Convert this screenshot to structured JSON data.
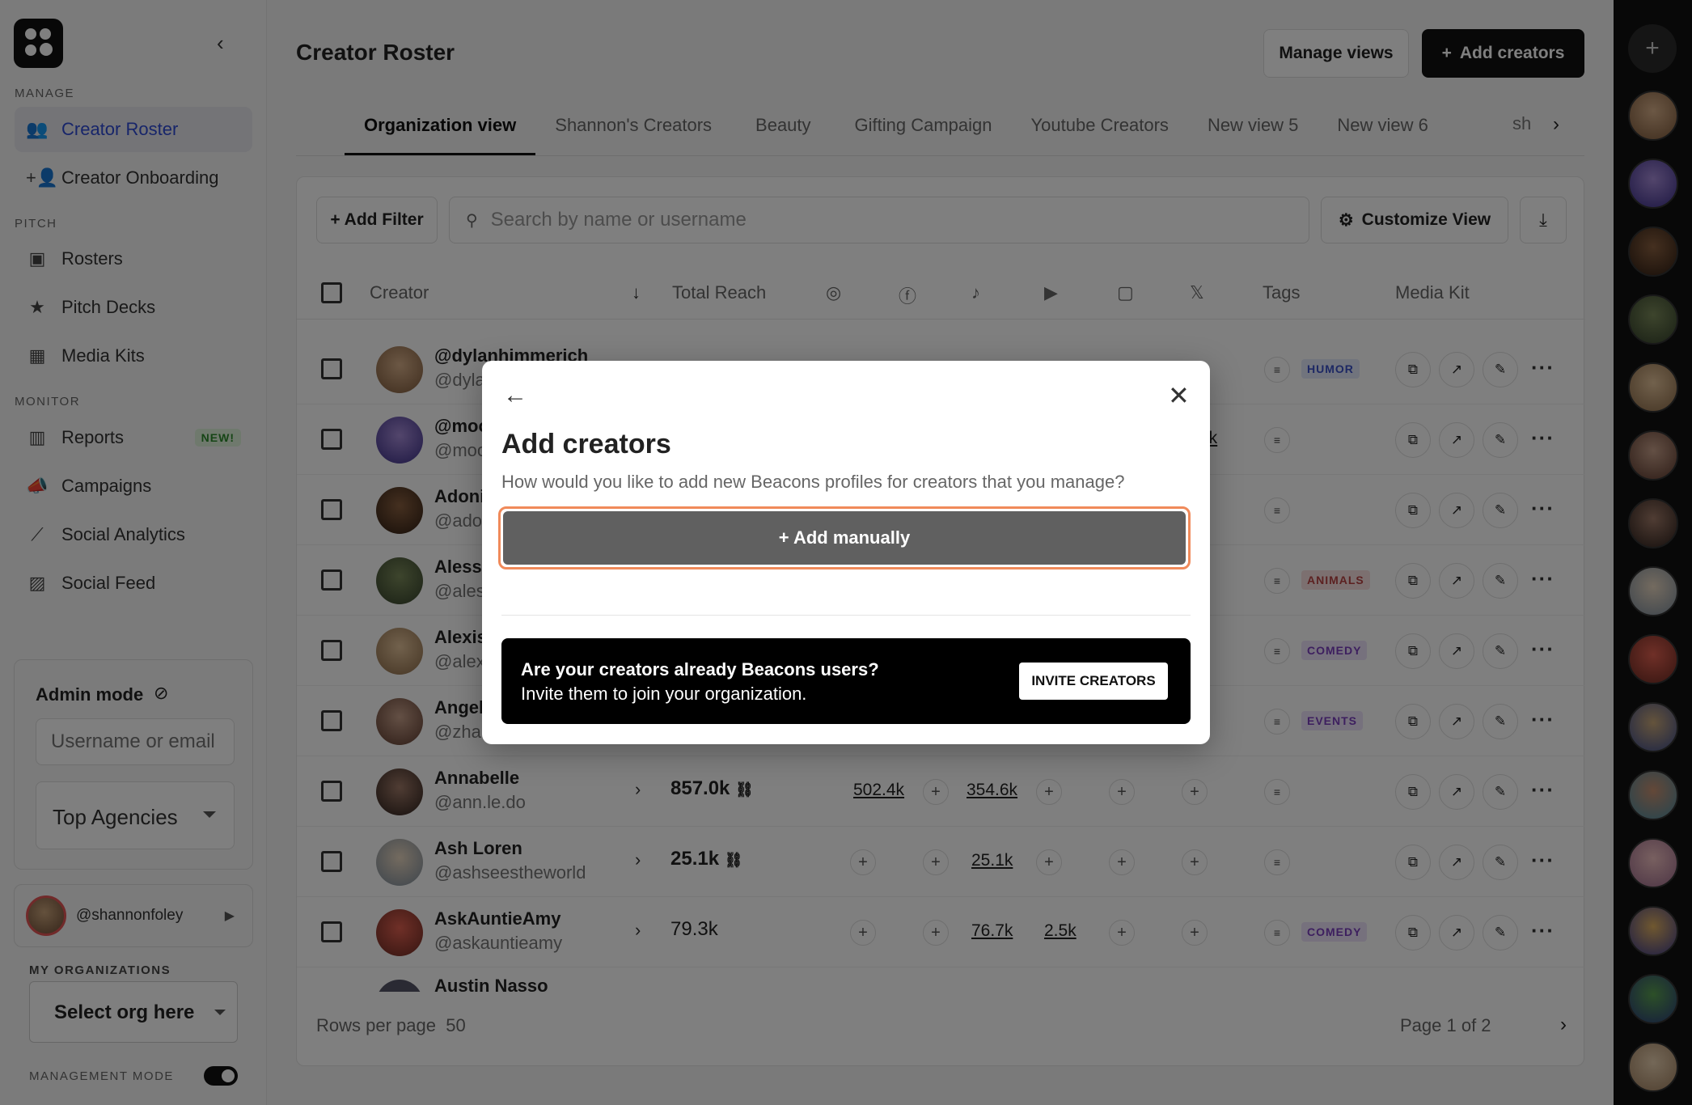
{
  "sidebar": {
    "sections": {
      "manage": "MANAGE",
      "pitch": "PITCH",
      "monitor": "MONITOR"
    },
    "items": [
      {
        "label": "Creator Roster",
        "icon": "people-icon"
      },
      {
        "label": "Creator Onboarding",
        "icon": "person-add-icon"
      },
      {
        "label": "Rosters",
        "icon": "contact-card-icon"
      },
      {
        "label": "Pitch Decks",
        "icon": "star-icon"
      },
      {
        "label": "Media Kits",
        "icon": "photo-grid-icon"
      },
      {
        "label": "Reports",
        "icon": "bar-chart-icon",
        "badge": "NEW!"
      },
      {
        "label": "Campaigns",
        "icon": "megaphone-icon"
      },
      {
        "label": "Social Analytics",
        "icon": "trend-line-icon"
      },
      {
        "label": "Social Feed",
        "icon": "image-icon"
      }
    ],
    "admin": {
      "title": "Admin mode",
      "input_placeholder": "Username or email",
      "select_value": "Top Agencies"
    },
    "user": {
      "handle": "@shannonfoley"
    },
    "orgs": {
      "label": "MY ORGANIZATIONS",
      "select_value": "Select org here"
    },
    "management_mode": {
      "label": "MANAGEMENT MODE",
      "on": true
    }
  },
  "header": {
    "title": "Creator Roster",
    "manage_views": "Manage views",
    "add_creators": "Add creators"
  },
  "tabs": [
    "Organization view",
    "Shannon's Creators",
    "Beauty",
    "Gifting Campaign",
    "Youtube Creators",
    "New view 5",
    "New view 6",
    "sh"
  ],
  "toolbar": {
    "add_filter": "+ Add Filter",
    "search_placeholder": "Search by name or username",
    "customize": "Customize View"
  },
  "table": {
    "columns": {
      "creator": "Creator",
      "total_reach": "Total Reach",
      "tags": "Tags",
      "media_kit": "Media Kit"
    },
    "rows": [
      {
        "name": "@dylanhimmerich",
        "handle": "@dylanhimmerich",
        "tag": "HUMOR"
      },
      {
        "name": "@moo",
        "handle": "@moo",
        "tag": ""
      },
      {
        "name": "Adonis",
        "handle": "@adonis",
        "tag": ""
      },
      {
        "name": "Alessya",
        "handle": "@alessya",
        "tag": "ANIMALS"
      },
      {
        "name": "Alexis",
        "handle": "@alexis",
        "tag": "COMEDY"
      },
      {
        "name": "Angel",
        "handle": "@zhau",
        "tag": "EVENTS"
      },
      {
        "name": "Annabelle",
        "handle": "@ann.le.do",
        "reach": "857.0k",
        "ig": "502.4k",
        "tt": "354.6k",
        "tag": ""
      },
      {
        "name": "Ash Loren",
        "handle": "@ashseestheworld",
        "reach": "25.1k",
        "tt": "25.1k",
        "tag": ""
      },
      {
        "name": "AskAuntieAmy",
        "handle": "@askauntieamy",
        "reach": "79.3k",
        "tt": "76.7k",
        "yt": "2.5k",
        "tag": "COMEDY"
      },
      {
        "name": "Austin Nasso",
        "handle": "",
        "tag": ""
      }
    ],
    "partial_values": {
      "row2_x": "7k",
      "row6_x": "k"
    }
  },
  "pager": {
    "rows_per_page_label": "Rows per page",
    "rows_per_page": "50",
    "page": "Page 1 of 2"
  },
  "modal": {
    "title": "Add creators",
    "subtitle": "How would you like to add new Beacons profiles for creators that you manage?",
    "add_manually": "+ Add manually",
    "invite_question": "Are your creators already Beacons users?",
    "invite_text": "Invite them to join your organization.",
    "invite_button": "INVITE CREATORS"
  },
  "colors": {
    "accent": "#2f4bd4",
    "highlight_border": "#f08a5a",
    "dark": "#111111"
  }
}
